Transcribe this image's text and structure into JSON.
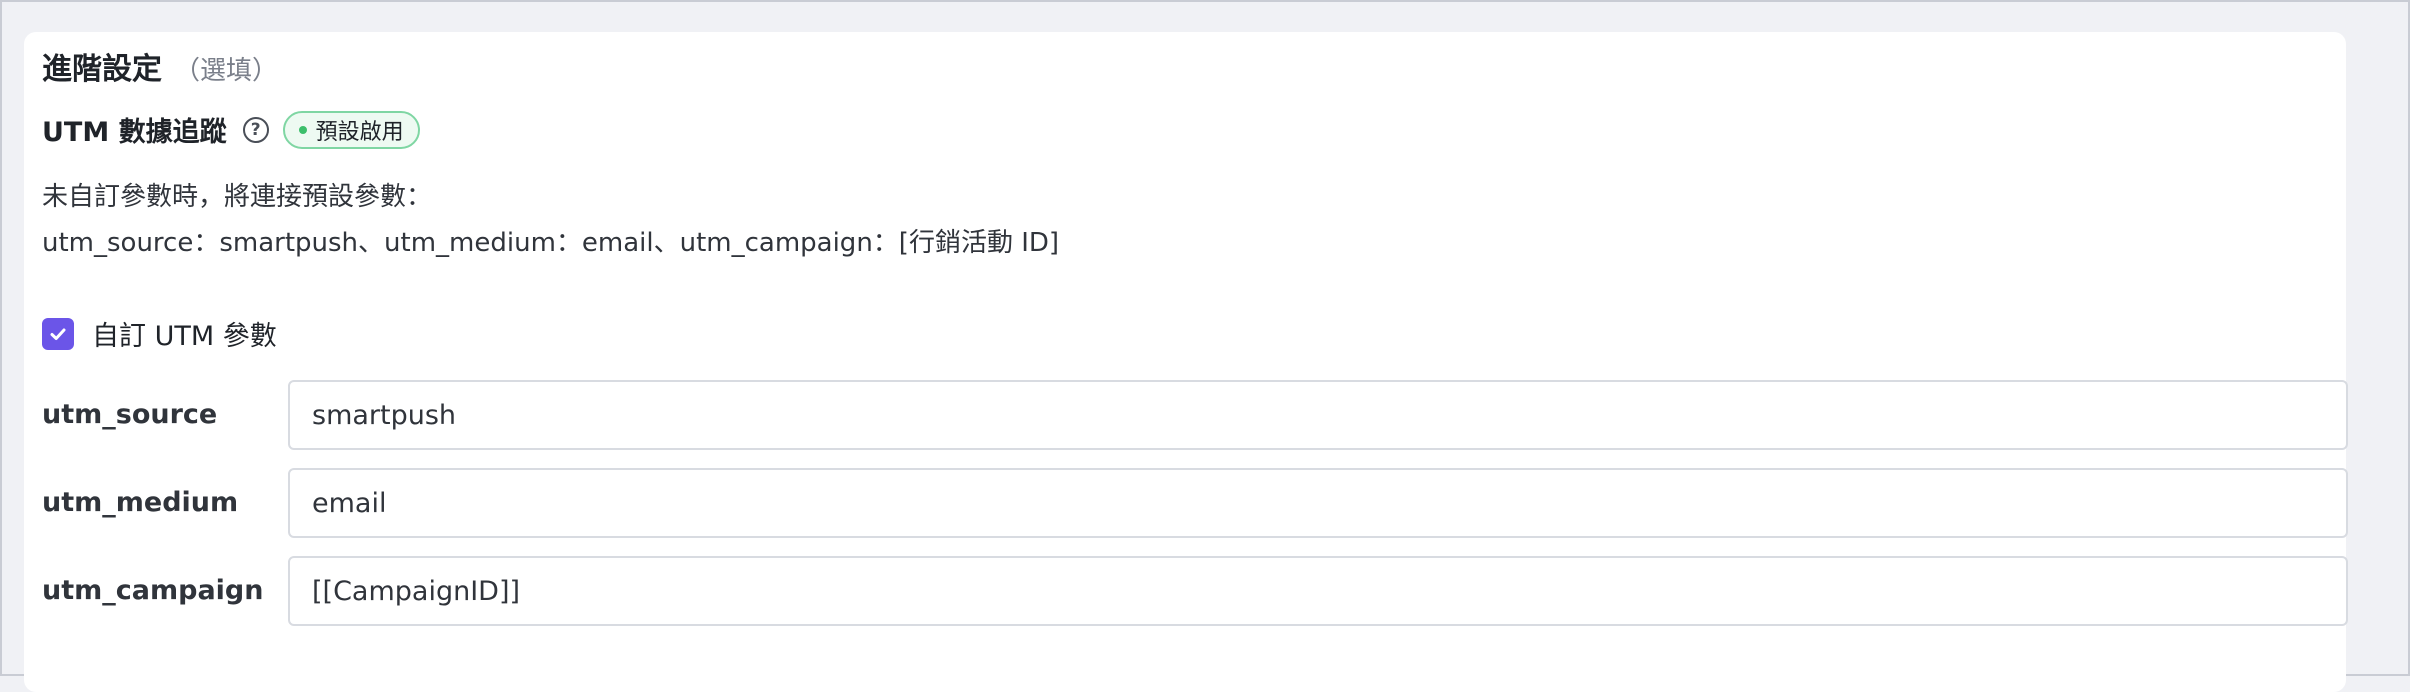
{
  "section": {
    "title": "進階設定",
    "optional_label": "（選填）"
  },
  "utm": {
    "label": "UTM 數據追蹤",
    "help_icon": "question-circle-icon",
    "badge_label": "預設啟用",
    "badge_color": "#3cbf6b",
    "description_line1": "未自訂參數時，將連接預設參數：",
    "description_line2": "utm_source：smartpush、utm_medium：email、utm_campaign：[行銷活動 ID]"
  },
  "custom_checkbox": {
    "label": "自訂 UTM 參數",
    "checked": true,
    "color": "#6b55e8"
  },
  "fields": [
    {
      "label": "utm_source",
      "value": "smartpush"
    },
    {
      "label": "utm_medium",
      "value": "email"
    },
    {
      "label": "utm_campaign",
      "value": "[[CampaignID]]"
    }
  ]
}
